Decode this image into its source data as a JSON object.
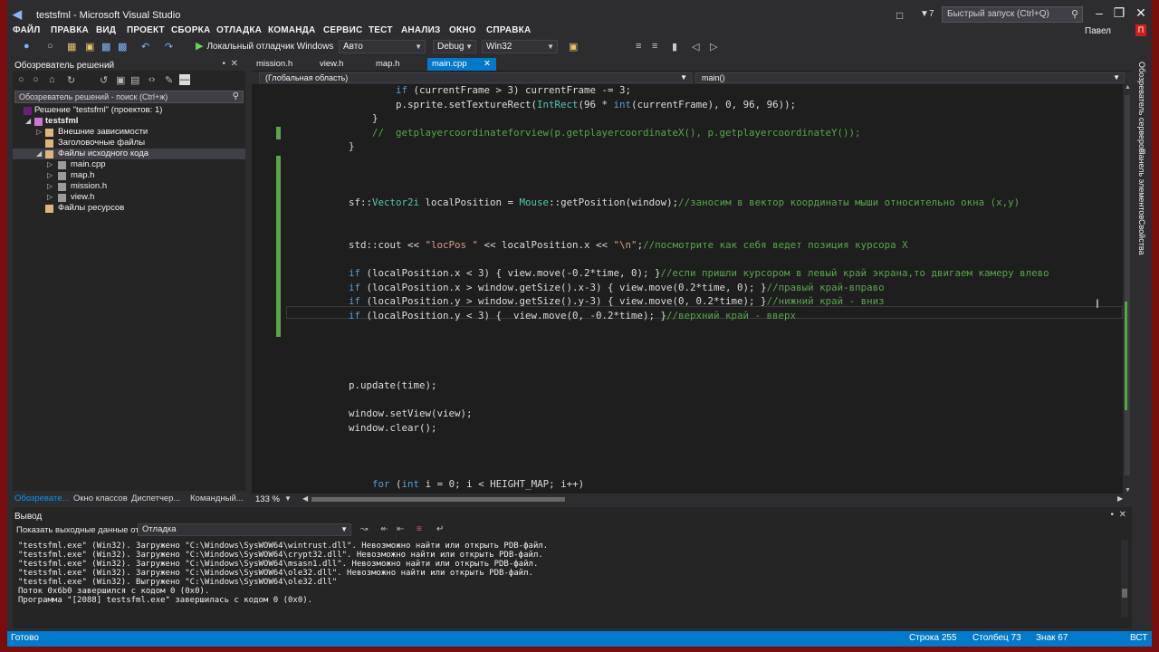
{
  "window": {
    "title": "testsfml - Microsoft Visual Studio"
  },
  "titlebar": {
    "notif_count": "7",
    "quick_launch_placeholder": "Быстрый запуск (Ctrl+Q)"
  },
  "menu": [
    "ФАЙЛ",
    "ПРАВКА",
    "ВИД",
    "ПРОЕКТ",
    "СБОРКА",
    "ОТЛАДКА",
    "КОМАНДА",
    "СЕРВИС",
    "ТЕСТ",
    "АНАЛИЗ",
    "ОКНО",
    "СПРАВКА"
  ],
  "user": {
    "name": "Павел",
    "initial": "П"
  },
  "toolbar": {
    "debugger": "Локальный отладчик Windows",
    "auto": "Авто",
    "config": "Debug",
    "platform": "Win32"
  },
  "solution_explorer": {
    "title": "Обозреватель решений",
    "search_placeholder": "Обозреватель решений - поиск (Ctrl+ж)",
    "tree": [
      {
        "label": "Решение \"testsfml\" (проектов: 1)"
      },
      {
        "label": "testsfml"
      },
      {
        "label": "Внешние зависимости"
      },
      {
        "label": "Заголовочные файлы"
      },
      {
        "label": "Файлы исходного кода"
      },
      {
        "label": "main.cpp"
      },
      {
        "label": "map.h"
      },
      {
        "label": "mission.h"
      },
      {
        "label": "view.h"
      },
      {
        "label": "Файлы ресурсов"
      }
    ],
    "bottom_tabs": [
      "Обозревате...",
      "Окно классов",
      "Диспетчер...",
      "Командный..."
    ]
  },
  "editor": {
    "tabs": [
      {
        "label": "mission.h"
      },
      {
        "label": "view.h"
      },
      {
        "label": "map.h"
      },
      {
        "label": "main.cpp"
      }
    ],
    "nav_scope": "(Глобальная область)",
    "nav_member": "main()",
    "zoom": "133 %"
  },
  "output": {
    "title": "Вывод",
    "show_label": "Показать выходные данные от:",
    "source": "Отладка",
    "lines": [
      "\"testsfml.exe\" (Win32). Загружено \"C:\\Windows\\SysWOW64\\wintrust.dll\". Невозможно найти или открыть PDB-файл.",
      "\"testsfml.exe\" (Win32). Загружено \"C:\\Windows\\SysWOW64\\crypt32.dll\". Невозможно найти или открыть PDB-файл.",
      "\"testsfml.exe\" (Win32). Загружено \"C:\\Windows\\SysWOW64\\msasn1.dll\". Невозможно найти или открыть PDB-файл.",
      "\"testsfml.exe\" (Win32). Загружено \"C:\\Windows\\SysWOW64\\ole32.dll\". Невозможно найти или открыть PDB-файл.",
      "\"testsfml.exe\" (Win32). Выгружено \"C:\\Windows\\SysWOW64\\ole32.dll\"",
      "Поток 0x6b0 завершился с кодом 0 (0x0).",
      "Программа \"[2088] testsfml.exe\" завершилась с кодом 0 (0x0)."
    ]
  },
  "right_panel": [
    "Обозреватель серверов",
    "Панель элементов",
    "Свойства"
  ],
  "status": {
    "ready": "Готово",
    "line": "Строка 255",
    "col": "Столбец 73",
    "char": "Знак 67",
    "mode": "ВСТ"
  },
  "colors": {
    "accent": "#007acc",
    "background": "#2d2d30",
    "editor_bg": "#1e1e1e",
    "changed_bar": "#57a64a"
  }
}
